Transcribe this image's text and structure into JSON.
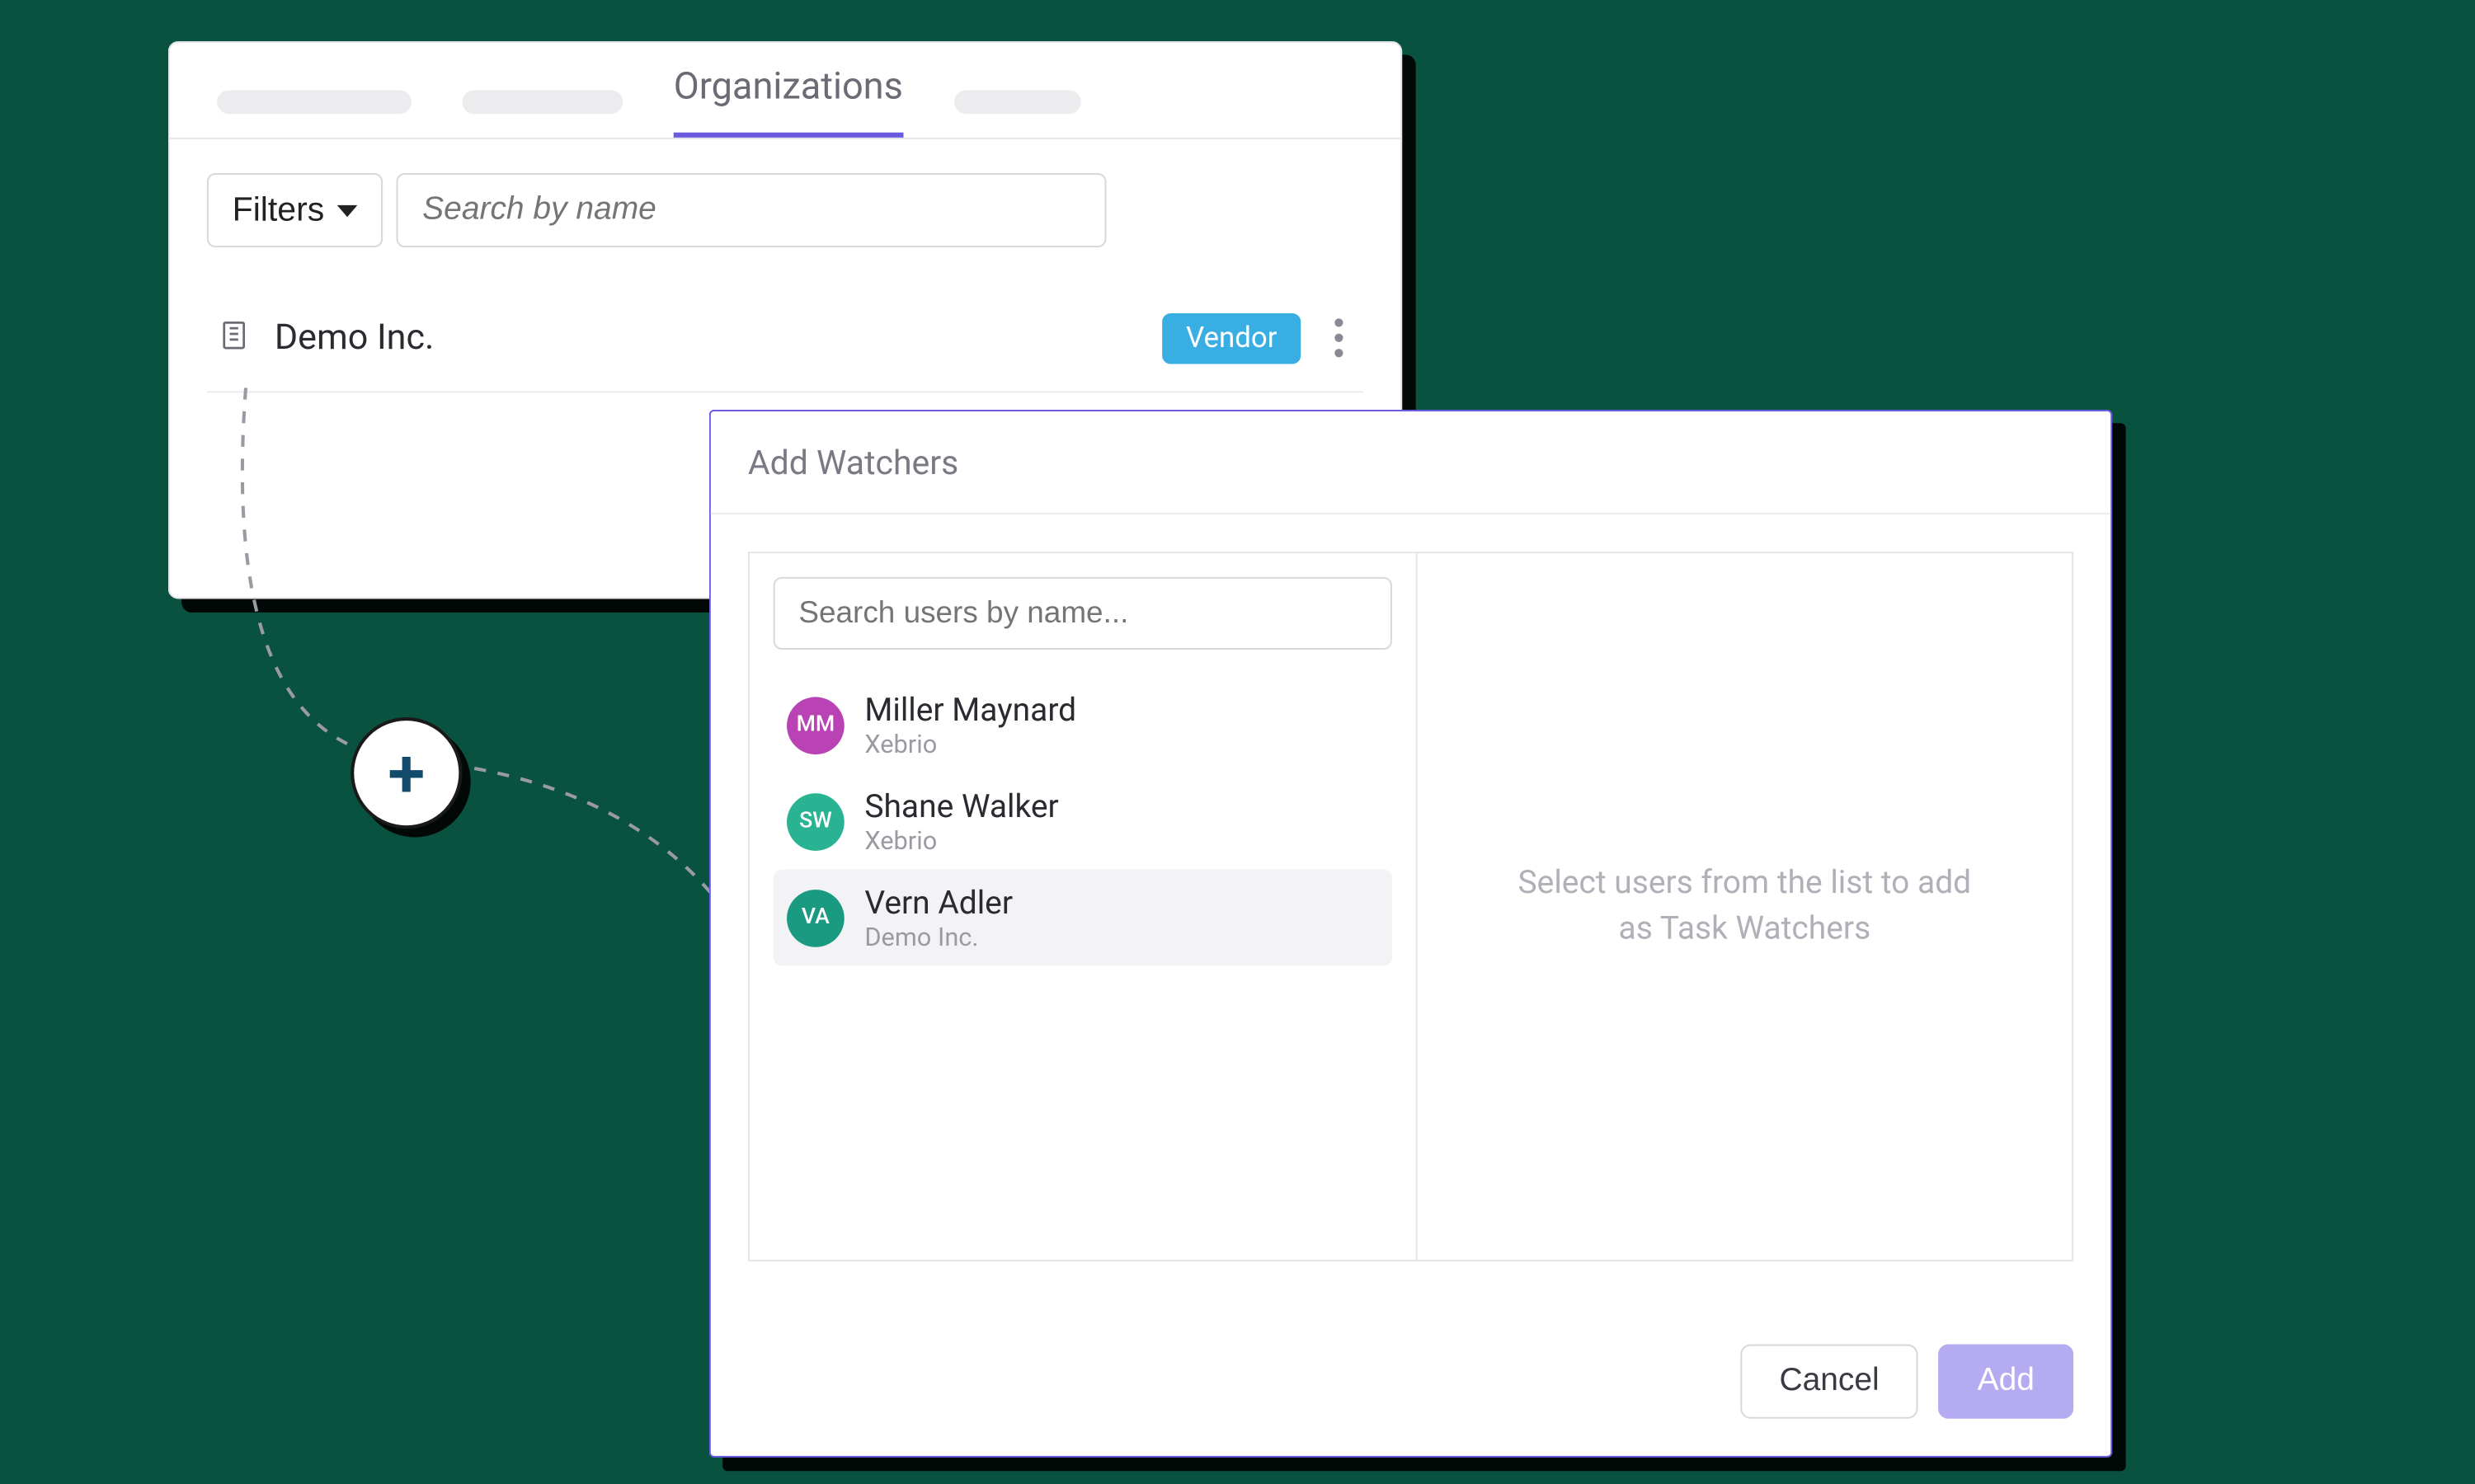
{
  "org_panel": {
    "active_tab": "Organizations",
    "filters_label": "Filters",
    "search_placeholder": "Search by name",
    "row": {
      "name": "Demo Inc.",
      "badge": "Vendor"
    }
  },
  "connector": {
    "plus_glyph": "+"
  },
  "modal": {
    "title": "Add Watchers",
    "search_placeholder": "Search users by name...",
    "users": [
      {
        "initials": "MM",
        "name": "Miller Maynard",
        "org": "Xebrio",
        "color": "#b942b4",
        "hover": false
      },
      {
        "initials": "SW",
        "name": "Shane Walker",
        "org": "Xebrio",
        "color": "#29b392",
        "hover": false
      },
      {
        "initials": "VA",
        "name": "Vern Adler",
        "org": "Demo Inc.",
        "color": "#1b9a82",
        "hover": true
      }
    ],
    "right_message": "Select users from the list to add as Task Watchers",
    "cancel_label": "Cancel",
    "add_label": "Add"
  }
}
